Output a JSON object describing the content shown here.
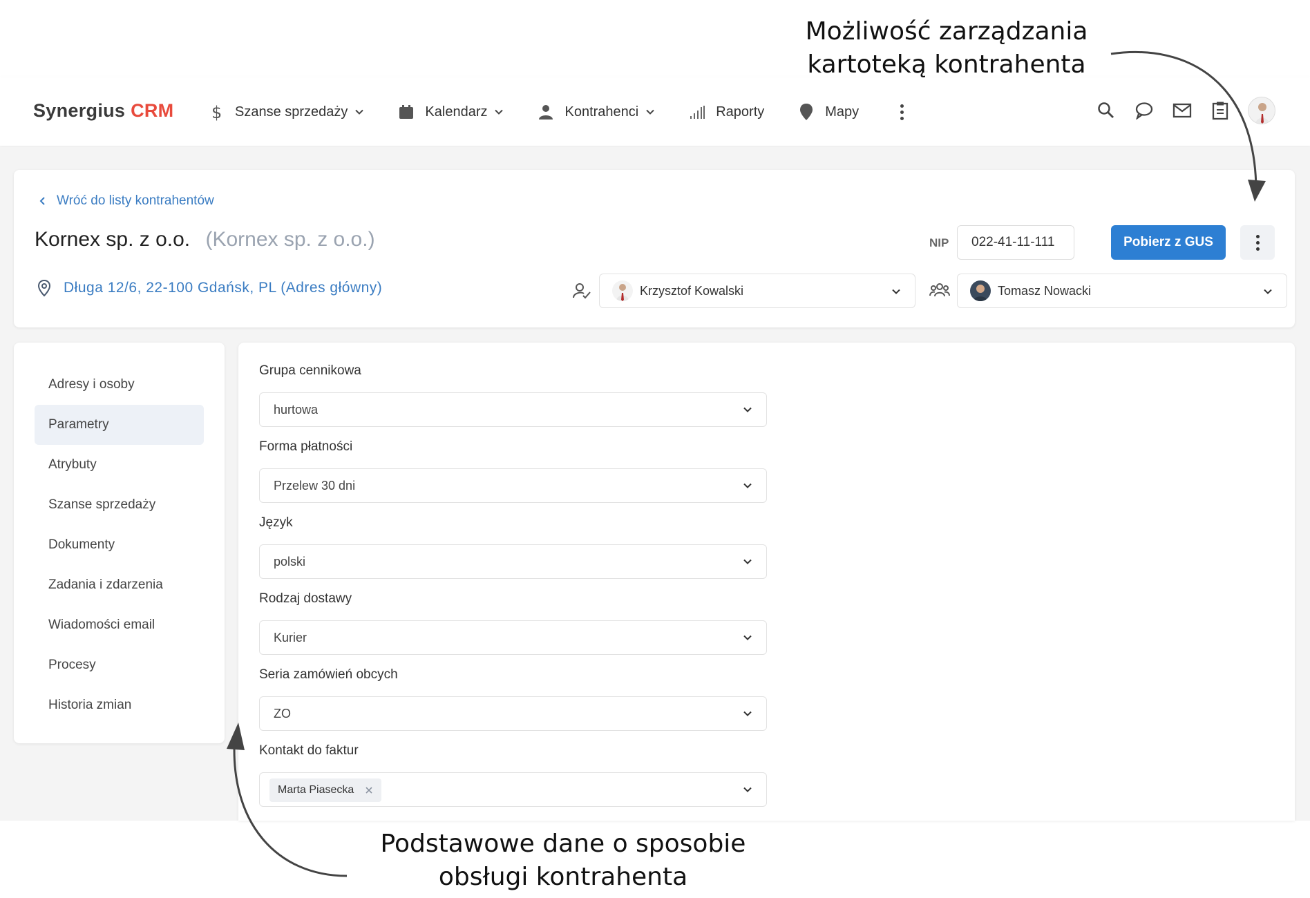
{
  "annotations": {
    "top_line1": "Możliwość zarządzania",
    "top_line2": "kartoteką kontrahenta",
    "bottom_line1": "Podstawowe dane o sposobie",
    "bottom_line2": "obsługi kontrahenta"
  },
  "nav": {
    "logo_main": "Synergius",
    "logo_crm": "CRM",
    "items": [
      {
        "label": "Szanse sprzedaży",
        "icon": "dollar-icon",
        "has_dropdown": true
      },
      {
        "label": "Kalendarz",
        "icon": "calendar-icon",
        "has_dropdown": true
      },
      {
        "label": "Kontrahenci",
        "icon": "person-icon",
        "has_dropdown": true
      },
      {
        "label": "Raporty",
        "icon": "signal-bars-icon",
        "has_dropdown": false
      },
      {
        "label": "Mapy",
        "icon": "map-pin-icon",
        "has_dropdown": false
      }
    ],
    "right_icons": [
      "search-icon",
      "chat-icon",
      "mail-icon",
      "clipboard-icon",
      "avatar"
    ]
  },
  "header": {
    "back_link": "Wróć do listy kontrahentów",
    "company_name": "Kornex sp. z o.o.",
    "company_alt_name": "(Kornex sp. z o.o.)",
    "nip_label": "NIP",
    "nip_value": "022-41-11-111",
    "gus_button": "Pobierz z GUS",
    "address": "Długa 12/6, 22-100 Gdańsk, PL (Adres główny)",
    "owner": "Krzysztof Kowalski",
    "team_member": "Tomasz Nowacki"
  },
  "side_menu": {
    "items": [
      {
        "label": "Adresy i osoby",
        "active": false
      },
      {
        "label": "Parametry",
        "active": true
      },
      {
        "label": "Atrybuty",
        "active": false
      },
      {
        "label": "Szanse sprzedaży",
        "active": false
      },
      {
        "label": "Dokumenty",
        "active": false
      },
      {
        "label": "Zadania i zdarzenia",
        "active": false
      },
      {
        "label": "Wiadomości email",
        "active": false
      },
      {
        "label": "Procesy",
        "active": false
      },
      {
        "label": "Historia zmian",
        "active": false
      }
    ]
  },
  "form": {
    "fields": [
      {
        "label": "Grupa cennikowa",
        "value": "hurtowa"
      },
      {
        "label": "Forma płatności",
        "value": "Przelew 30 dni"
      },
      {
        "label": "Język",
        "value": "polski"
      },
      {
        "label": "Rodzaj dostawy",
        "value": "Kurier"
      },
      {
        "label": "Seria zamówień obcych",
        "value": "ZO"
      },
      {
        "label": "Kontakt do faktur",
        "tag": "Marta Piasecka"
      }
    ]
  },
  "colors": {
    "accent_blue": "#2d7fd3",
    "link_blue": "#3a7cc2",
    "brand_red": "#e84a3c"
  }
}
